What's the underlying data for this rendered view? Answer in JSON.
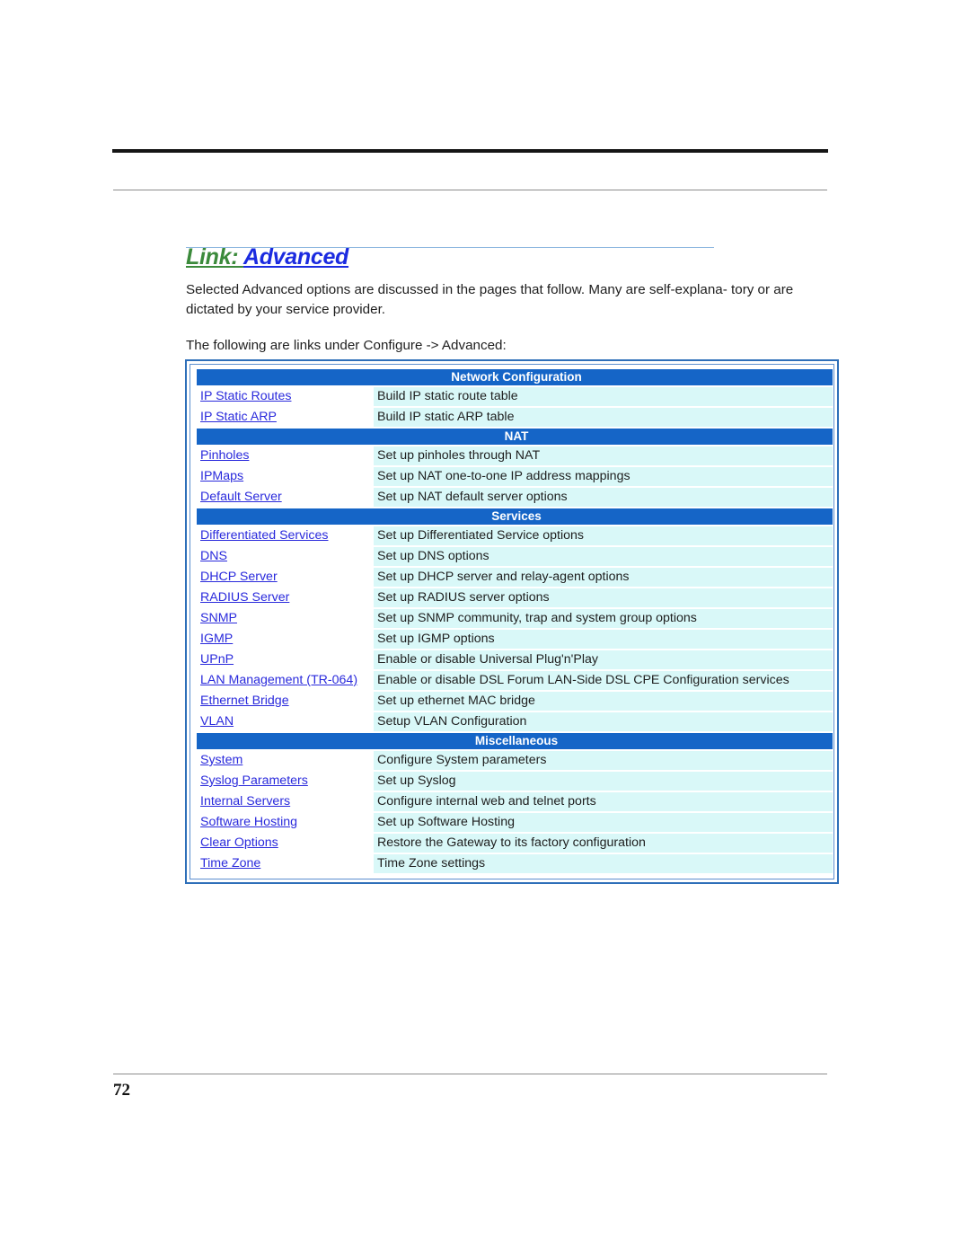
{
  "heading": {
    "prefix": "Link: ",
    "link": "Advanced"
  },
  "intro": "Selected Advanced options are discussed in the pages that follow. Many are self-explana- tory or are dictated by your service provider.",
  "list_intro": "The following are links under Configure -> Advanced:",
  "sections": [
    {
      "title": "Network Configuration",
      "rows": [
        {
          "link": "IP Static Routes",
          "desc": "Build IP static route table"
        },
        {
          "link": "IP Static ARP",
          "desc": "Build IP static ARP table"
        }
      ]
    },
    {
      "title": "NAT",
      "rows": [
        {
          "link": "Pinholes",
          "desc": "Set up pinholes through NAT"
        },
        {
          "link": "IPMaps",
          "desc": "Set up NAT one-to-one IP address mappings"
        },
        {
          "link": "Default Server",
          "desc": "Set up NAT default server options"
        }
      ]
    },
    {
      "title": "Services",
      "rows": [
        {
          "link": "Differentiated Services",
          "desc": "Set up Differentiated Service options"
        },
        {
          "link": "DNS",
          "desc": "Set up DNS options"
        },
        {
          "link": "DHCP Server",
          "desc": "Set up DHCP server and relay-agent options"
        },
        {
          "link": "RADIUS Server",
          "desc": "Set up RADIUS server options"
        },
        {
          "link": "SNMP",
          "desc": "Set up SNMP community, trap and system group options"
        },
        {
          "link": "IGMP",
          "desc": "Set up IGMP options"
        },
        {
          "link": "UPnP",
          "desc": "Enable or disable Universal Plug'n'Play"
        },
        {
          "link": "LAN Management (TR-064)",
          "desc": "Enable or disable DSL Forum LAN-Side DSL CPE Configuration services"
        },
        {
          "link": "Ethernet Bridge",
          "desc": "Set up ethernet MAC bridge"
        },
        {
          "link": "VLAN",
          "desc": "Setup VLAN Configuration"
        }
      ]
    },
    {
      "title": "Miscellaneous",
      "rows": [
        {
          "link": "System",
          "desc": "Configure System parameters"
        },
        {
          "link": "Syslog Parameters",
          "desc": "Set up Syslog"
        },
        {
          "link": "Internal Servers",
          "desc": "Configure internal web and telnet ports"
        },
        {
          "link": "Software Hosting",
          "desc": "Set up Software Hosting"
        },
        {
          "link": "Clear Options",
          "desc": "Restore the Gateway to its factory configuration"
        },
        {
          "link": "Time Zone",
          "desc": "Time Zone settings"
        }
      ]
    }
  ],
  "page_number": "72"
}
